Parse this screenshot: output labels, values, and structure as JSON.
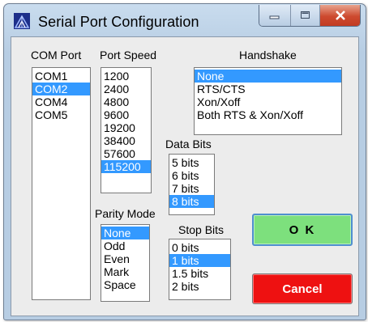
{
  "window": {
    "title": "Serial Port Configuration"
  },
  "com_port": {
    "label": "COM Port",
    "items": [
      "COM1",
      "COM2",
      "COM4",
      "COM5"
    ],
    "selected": "COM2"
  },
  "port_speed": {
    "label": "Port Speed",
    "items": [
      "1200",
      "2400",
      "4800",
      "9600",
      "19200",
      "38400",
      "57600",
      "115200"
    ],
    "selected": "115200"
  },
  "handshake": {
    "label": "Handshake",
    "items": [
      "None",
      "RTS/CTS",
      "Xon/Xoff",
      "Both RTS & Xon/Xoff"
    ],
    "selected": "None"
  },
  "data_bits": {
    "label": "Data Bits",
    "items": [
      "5 bits",
      "6 bits",
      "7 bits",
      "8 bits"
    ],
    "selected": "8 bits"
  },
  "parity_mode": {
    "label": "Parity Mode",
    "items": [
      "None",
      "Odd",
      "Even",
      "Mark",
      "Space"
    ],
    "selected": "None"
  },
  "stop_bits": {
    "label": "Stop Bits",
    "items": [
      "0 bits",
      "1 bits",
      "1.5 bits",
      "2 bits"
    ],
    "selected": "1 bits"
  },
  "buttons": {
    "ok": "O K",
    "cancel": "Cancel"
  },
  "colors": {
    "selection": "#3399ff",
    "ok_button": "#7de07d",
    "cancel_button": "#ee1111"
  }
}
